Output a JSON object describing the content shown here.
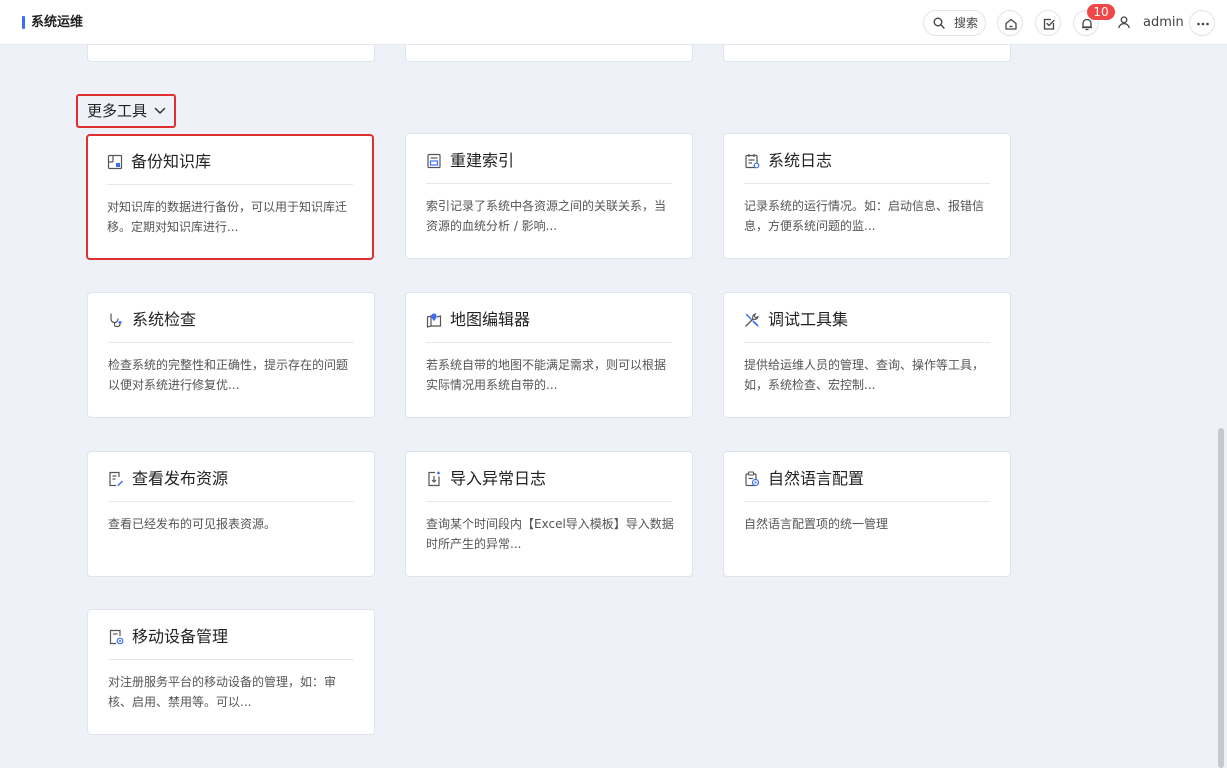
{
  "header": {
    "title": "系统运维",
    "search_label": "搜索",
    "notification_count": "10",
    "username": "admin",
    "accent_color": "#3b6ef5",
    "badge_color": "#f04848"
  },
  "section": {
    "title": "更多工具",
    "highlight_color": "#e02f2f"
  },
  "cards": [
    {
      "icon": "backup-icon",
      "title": "备份知识库",
      "desc": "对知识库的数据进行备份，可以用于知识库迁移。定期对知识库进行..."
    },
    {
      "icon": "index-icon",
      "title": "重建索引",
      "desc": "索引记录了系统中各资源之间的关联关系，当资源的血统分析 / 影响..."
    },
    {
      "icon": "log-icon",
      "title": "系统日志",
      "desc": "记录系统的运行情况。如：启动信息、报错信息，方便系统问题的监..."
    },
    {
      "icon": "stethoscope-icon",
      "title": "系统检查",
      "desc": "检查系统的完整性和正确性，提示存在的问题以便对系统进行修复优..."
    },
    {
      "icon": "map-icon",
      "title": "地图编辑器",
      "desc": "若系统自带的地图不能满足需求，则可以根据实际情况用系统自带的..."
    },
    {
      "icon": "tools-icon",
      "title": "调试工具集",
      "desc": "提供给运维人员的管理、查询、操作等工具，如，系统检查、宏控制..."
    },
    {
      "icon": "edit-document-icon",
      "title": "查看发布资源",
      "desc": "查看已经发布的可见报表资源。"
    },
    {
      "icon": "import-icon",
      "title": "导入异常日志",
      "desc": "查询某个时间段内【Excel导入模板】导入数据时所产生的异常..."
    },
    {
      "icon": "language-config-icon",
      "title": "自然语言配置",
      "desc": "自然语言配置项的统一管理"
    },
    {
      "icon": "mobile-device-icon",
      "title": "移动设备管理",
      "desc": "对注册服务平台的移动设备的管理，如：审核、启用、禁用等。可以..."
    }
  ]
}
